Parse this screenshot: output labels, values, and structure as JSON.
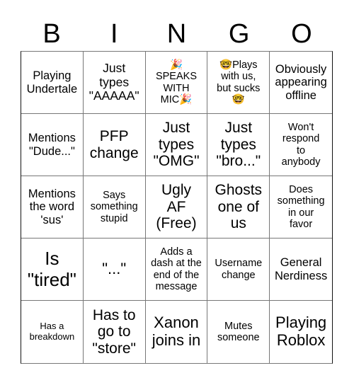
{
  "header": {
    "letters": [
      "B",
      "I",
      "N",
      "G",
      "O"
    ]
  },
  "cells": [
    {
      "text": "Playing\nUndertale",
      "size": "s16"
    },
    {
      "text": "Just\ntypes\n\"AAAAA\"",
      "size": "s17"
    },
    {
      "text": "🎉\nSPEAKS\nWITH\nMIC🎉",
      "size": "s14"
    },
    {
      "text": "🤓Plays\nwith us,\nbut sucks\n🤓",
      "size": "s14"
    },
    {
      "text": "Obviously\nappearing\noffline",
      "size": "s16"
    },
    {
      "text": "Mentions\n\"Dude...\"",
      "size": "s16"
    },
    {
      "text": "PFP\nchange",
      "size": "s20"
    },
    {
      "text": "Just\ntypes\n\"OMG\"",
      "size": "s20"
    },
    {
      "text": "Just\ntypes\n\"bro...\"",
      "size": "s20"
    },
    {
      "text": "Won't\nrespond\nto\nanybody",
      "size": "s14"
    },
    {
      "text": "Mentions\nthe word\n'sus'",
      "size": "s16"
    },
    {
      "text": "Says\nsomething\nstupid",
      "size": "s14"
    },
    {
      "text": "Ugly\nAF\n(Free)",
      "size": "s20"
    },
    {
      "text": "Ghosts\none of\nus",
      "size": "s20"
    },
    {
      "text": "Does\nsomething\nin our\nfavor",
      "size": "s14"
    },
    {
      "text": "Is\n\"tired\"",
      "size": "s26"
    },
    {
      "text": "\"...\"",
      "size": "s22"
    },
    {
      "text": "Adds a\ndash at the\nend of the\nmessage",
      "size": "s14"
    },
    {
      "text": "Username\nchange",
      "size": "s14"
    },
    {
      "text": "General\nNerdiness",
      "size": "s16"
    },
    {
      "text": "Has a\nbreakdown",
      "size": "s13"
    },
    {
      "text": "Has to\ngo to\n\"store\"",
      "size": "s20"
    },
    {
      "text": "Xanon\njoins in",
      "size": "s22"
    },
    {
      "text": "Mutes\nsomeone",
      "size": "s14"
    },
    {
      "text": "Playing\nRoblox",
      "size": "s22"
    }
  ]
}
